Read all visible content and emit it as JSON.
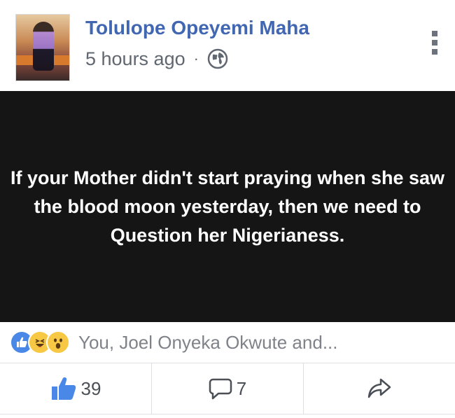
{
  "post": {
    "author": "Tolulope Opeyemi Maha",
    "time": "5 hours ago",
    "separator": "·",
    "privacy_icon": "globe-icon",
    "menu_icon": "more-options-icon"
  },
  "content": {
    "text": "If your Mother didn't start praying when she saw the blood moon yesterday, then we need to Question her Nigerianess.",
    "background_color": "#151515",
    "text_color": "#ffffff"
  },
  "reactions": {
    "icons": [
      "like-reaction-icon",
      "haha-reaction-icon",
      "wow-reaction-icon"
    ],
    "summary": "You, Joel Onyeka Okwute and..."
  },
  "actions": {
    "like_count": "39",
    "comment_count": "7",
    "like_icon": "thumbs-up-icon",
    "comment_icon": "comment-icon",
    "share_icon": "share-icon"
  },
  "colors": {
    "accent": "#4267b2",
    "like_blue": "#4a88e8"
  }
}
